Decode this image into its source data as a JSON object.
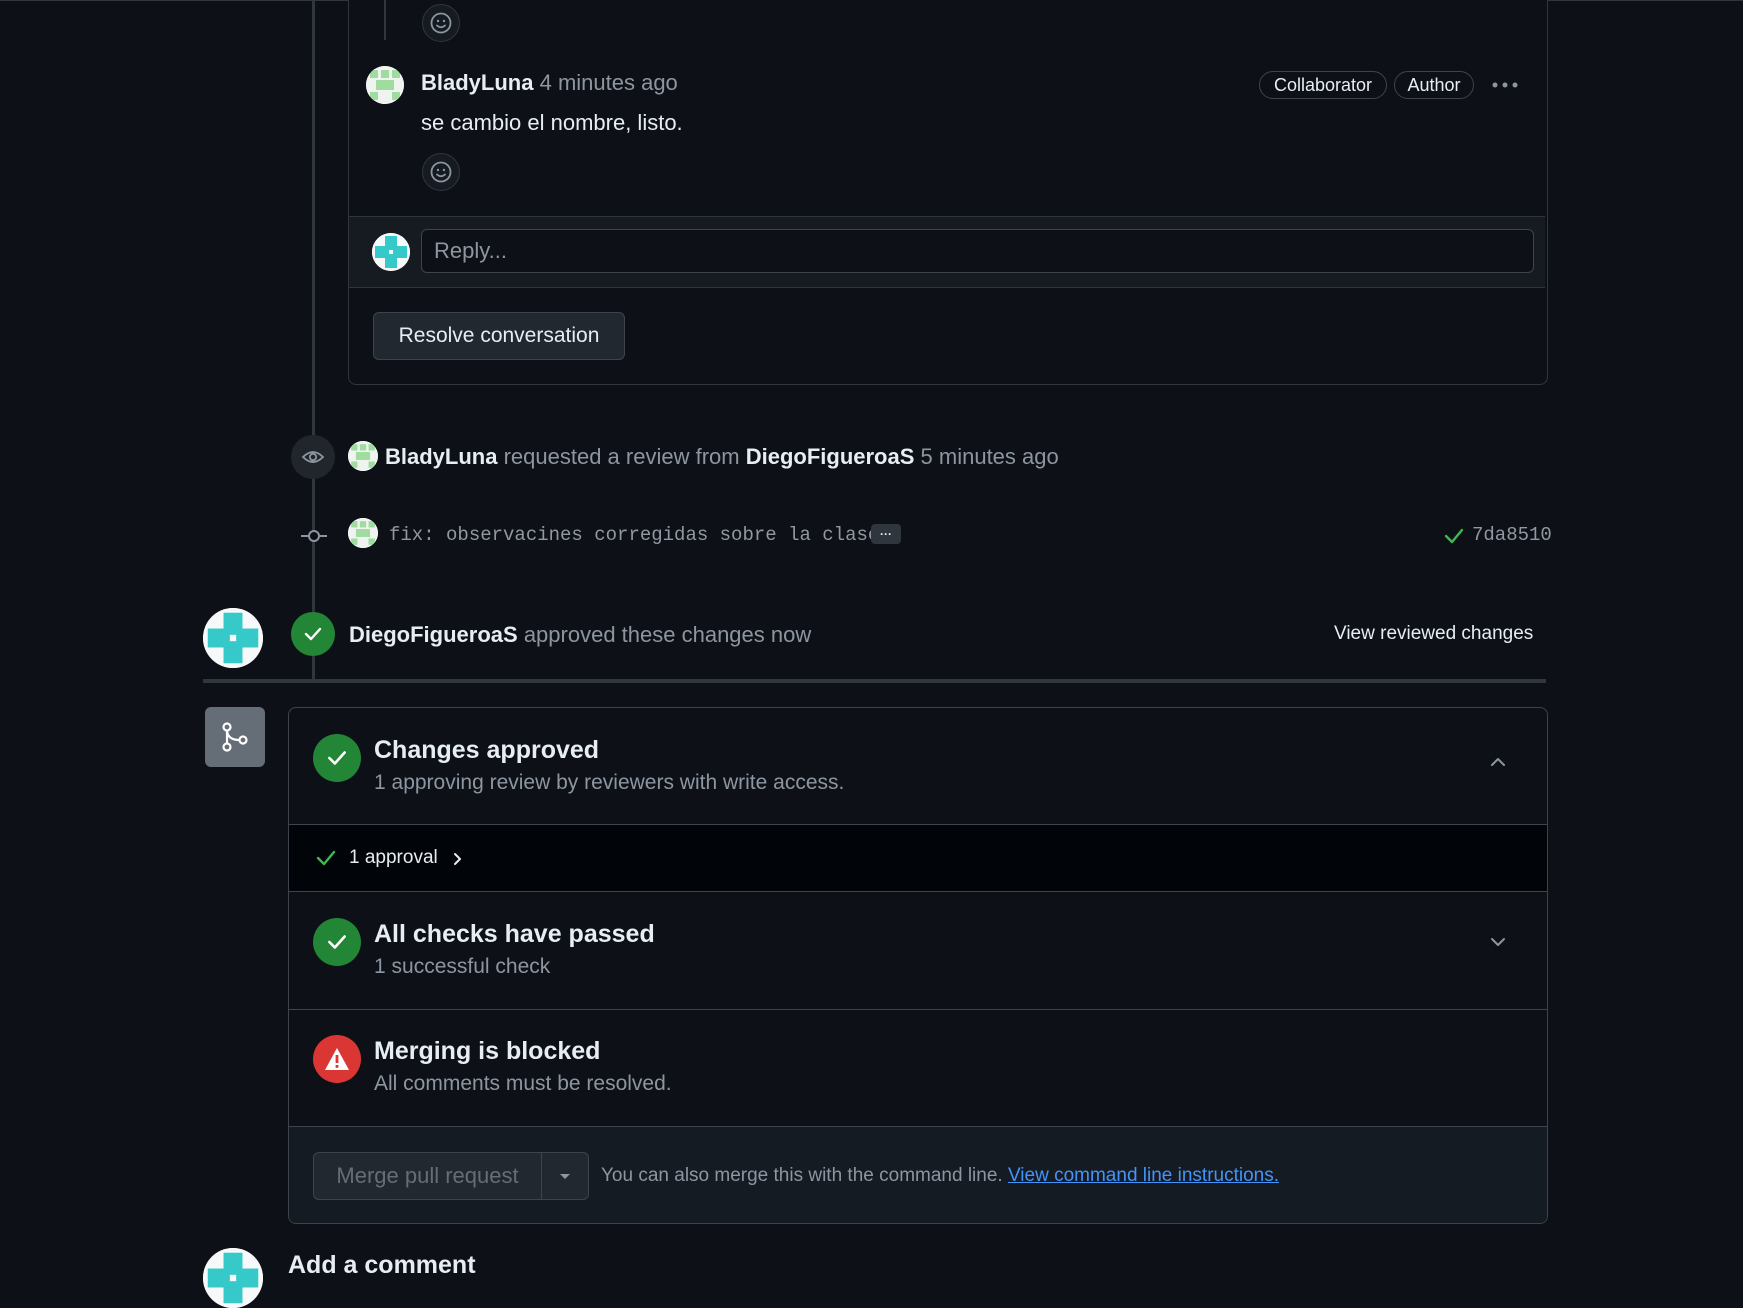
{
  "thread": {
    "comment_author": "BladyLuna",
    "comment_time": "4 minutes ago",
    "comment_body": "se cambio el nombre, listo.",
    "badges": [
      "Collaborator",
      "Author"
    ],
    "reply_placeholder": "Reply...",
    "resolve_label": "Resolve conversation"
  },
  "review_request": {
    "actor": "BladyLuna",
    "text": "requested a review from",
    "target": "DiegoFigueroaS",
    "time": "5 minutes ago"
  },
  "commit": {
    "message": "fix: observacines corregidas sobre la clase",
    "ellipsis": "···",
    "sha": "7da8510"
  },
  "approval_event": {
    "actor": "DiegoFigueroaS",
    "text": "approved these changes now",
    "view_link": "View reviewed changes"
  },
  "merge": {
    "approved_title": "Changes approved",
    "approved_sub": "1 approving review by reviewers with write access.",
    "approval_count": "1 approval",
    "checks_title": "All checks have passed",
    "checks_sub": "1 successful check",
    "blocked_title": "Merging is blocked",
    "blocked_sub": "All comments must be resolved.",
    "merge_button": "Merge pull request",
    "cli_text": "You can also merge this with the command line.",
    "cli_link": "View command line instructions."
  },
  "add_comment": {
    "title": "Add a comment"
  },
  "colors": {
    "success": "#238636",
    "danger": "#da3633",
    "link": "#4493f8",
    "bg": "#0d1117"
  }
}
